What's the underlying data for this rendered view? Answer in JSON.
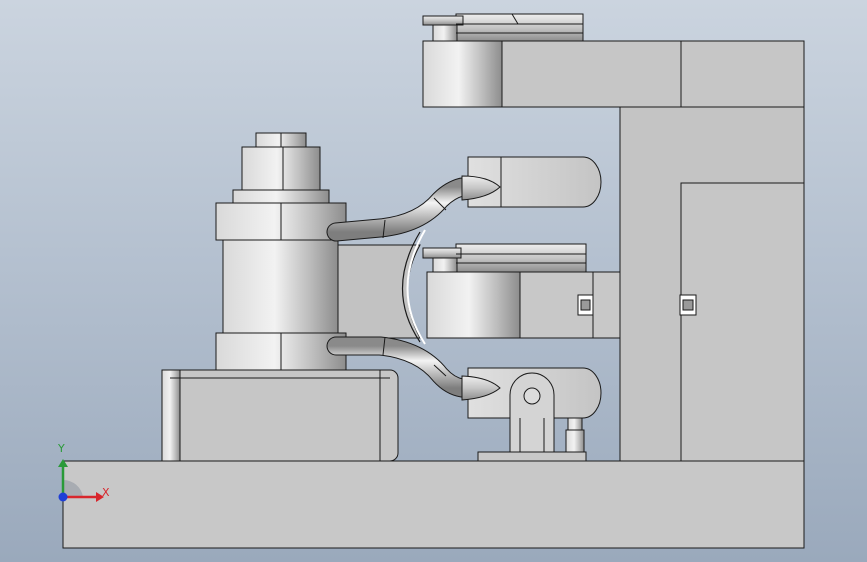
{
  "viewport": {
    "background_top": "#cbd4df",
    "background_bottom": "#9aa9bc"
  },
  "triad": {
    "x_label": "X",
    "y_label": "Y",
    "x_color": "#d8262c",
    "y_color": "#2a9a38",
    "z_color": "#1f3fd6"
  },
  "model": {
    "part_fill": "#c9c9c9",
    "part_shade": "#9a9a9a",
    "edge_color": "#1a1a1a"
  }
}
